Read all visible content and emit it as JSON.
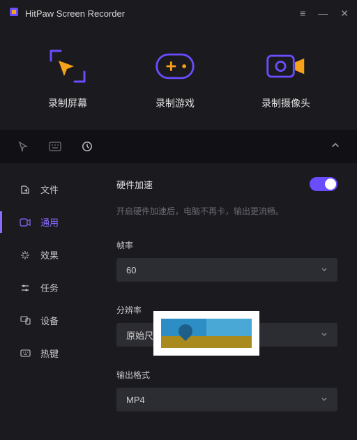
{
  "window": {
    "title": "HitPaw Screen Recorder"
  },
  "modes": [
    {
      "name": "record-screen",
      "label": "录制屏幕"
    },
    {
      "name": "record-game",
      "label": "录制游戏"
    },
    {
      "name": "record-webcam",
      "label": "录制摄像头"
    }
  ],
  "sidebar": {
    "items": [
      {
        "name": "files",
        "label": "文件"
      },
      {
        "name": "general",
        "label": "通用"
      },
      {
        "name": "effects",
        "label": "效果"
      },
      {
        "name": "tasks",
        "label": "任务"
      },
      {
        "name": "devices",
        "label": "设备"
      },
      {
        "name": "hotkeys",
        "label": "热键"
      }
    ],
    "active_index": 1
  },
  "panel": {
    "hw_accel": {
      "title": "硬件加速",
      "hint": "开启硬件加速后，电脑不再卡，输出更流畅。",
      "enabled": true
    },
    "framerate": {
      "label": "帧率",
      "value": "60"
    },
    "resolution": {
      "label": "分辨率",
      "value": "原始尺"
    },
    "output_format": {
      "label": "输出格式",
      "value": "MP4"
    }
  },
  "icons": {
    "menu": "menu-icon",
    "minimize": "minimize-icon",
    "close": "close-icon",
    "cursor": "cursor-icon",
    "keyboard": "keyboard-icon",
    "history": "history-icon",
    "collapse": "chevron-up-icon",
    "chevron_down": "chevron-down-icon"
  }
}
